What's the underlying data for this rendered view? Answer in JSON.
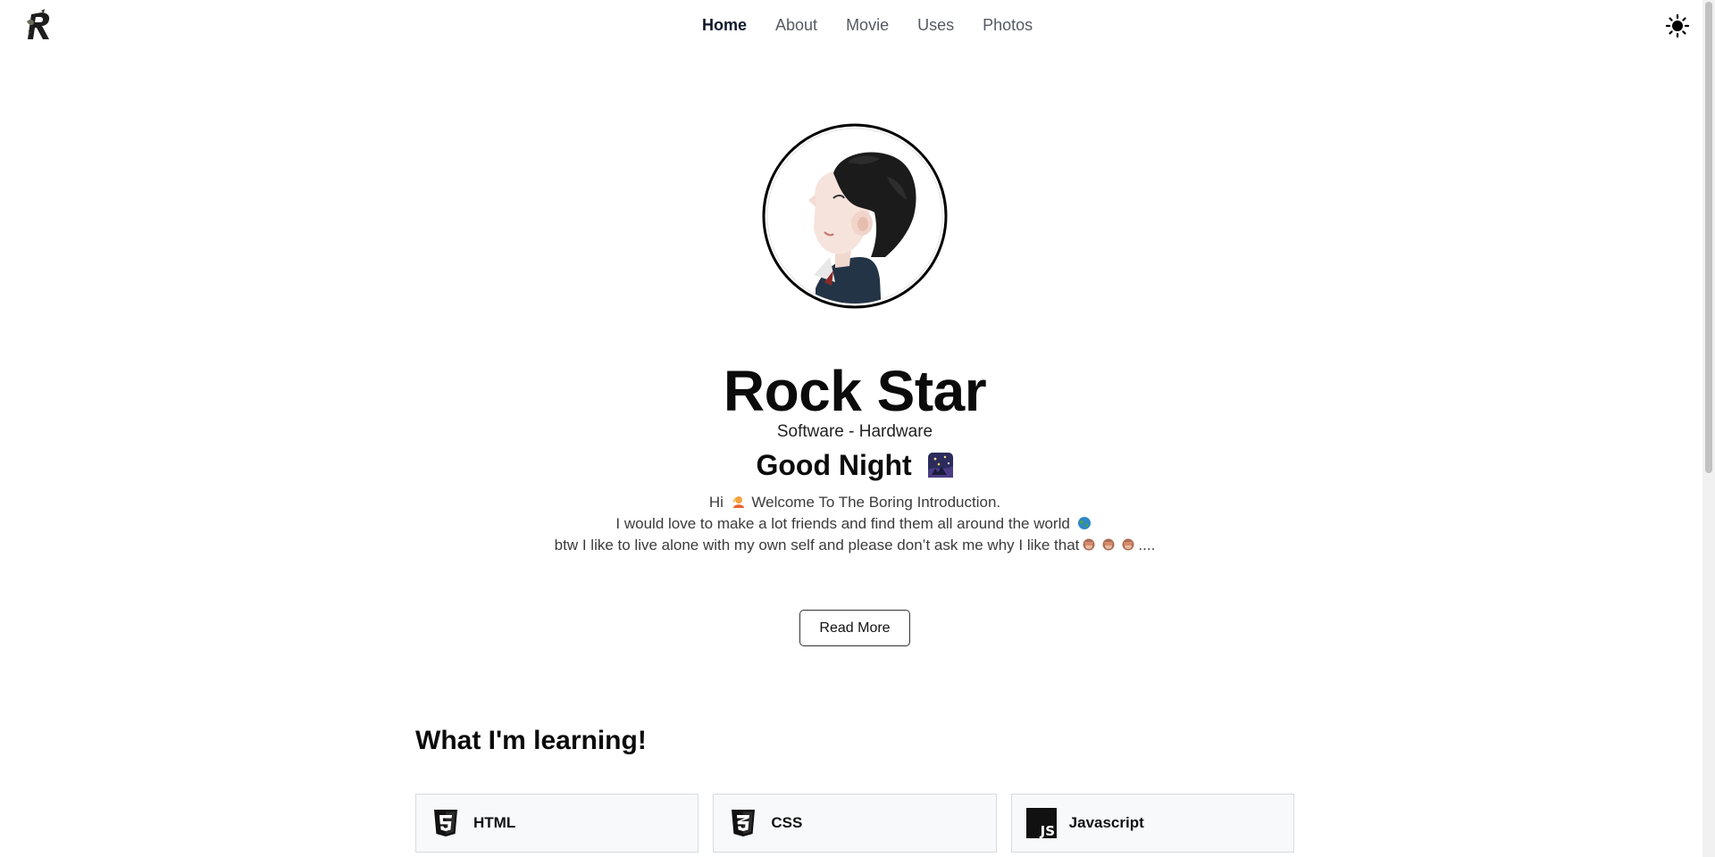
{
  "nav": {
    "items": [
      {
        "label": "Home"
      },
      {
        "label": "About"
      },
      {
        "label": "Movie"
      },
      {
        "label": "Uses"
      },
      {
        "label": "Photos"
      }
    ]
  },
  "hero": {
    "name": "Rock Star",
    "subtitle": "Software - Hardware",
    "greeting": "Good Night",
    "intro": {
      "line1_a": "Hi",
      "line1_b": "Welcome To The Boring Introduction.",
      "line2": "I would love to make a lot friends and find them all around the world",
      "line3_a": "btw I like to live alone with my own self and please don’t ask me why I like that",
      "line3_b": "...."
    },
    "read_more": "Read More"
  },
  "learning": {
    "title": "What I'm learning!",
    "items": [
      {
        "label": "HTML",
        "icon": "html5-icon"
      },
      {
        "label": "CSS",
        "icon": "css3-icon"
      },
      {
        "label": "Javascript",
        "icon": "javascript-icon"
      }
    ]
  },
  "colors": {
    "text": "#0b0b0b",
    "nav_inactive": "#555a63",
    "card_bg": "#f8f9fa",
    "card_border": "#d7dbe0"
  }
}
